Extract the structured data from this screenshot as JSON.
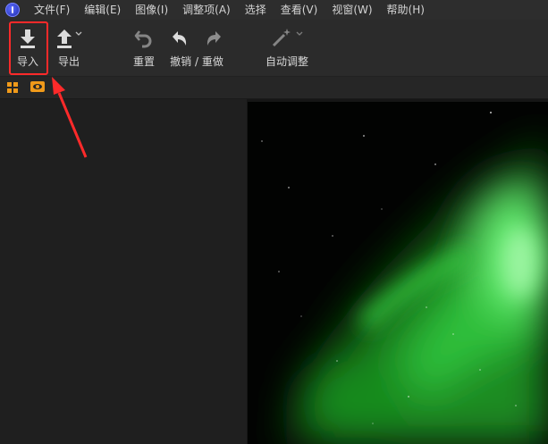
{
  "menu": {
    "items": [
      "文件(F)",
      "编辑(E)",
      "图像(I)",
      "调整项(A)",
      "选择",
      "查看(V)",
      "视窗(W)",
      "帮助(H)"
    ]
  },
  "toolbar": {
    "import_label": "导入",
    "export_label": "导出",
    "reset_label": "重置",
    "undo_redo_label": "撤销 / 重做",
    "auto_adjust_label": "自动调整"
  },
  "icons": {
    "app_logo": "app-logo-icon",
    "import": "download-icon",
    "export": "upload-icon",
    "reset": "reset-icon",
    "undo": "undo-icon",
    "redo": "redo-icon",
    "auto_adjust": "magic-wand-icon",
    "grid_view": "grid-icon",
    "preview": "eye-icon"
  },
  "colors": {
    "highlight": "#ff2a2a",
    "accent": "#f09a1a",
    "aurora": "#2ecc40"
  }
}
